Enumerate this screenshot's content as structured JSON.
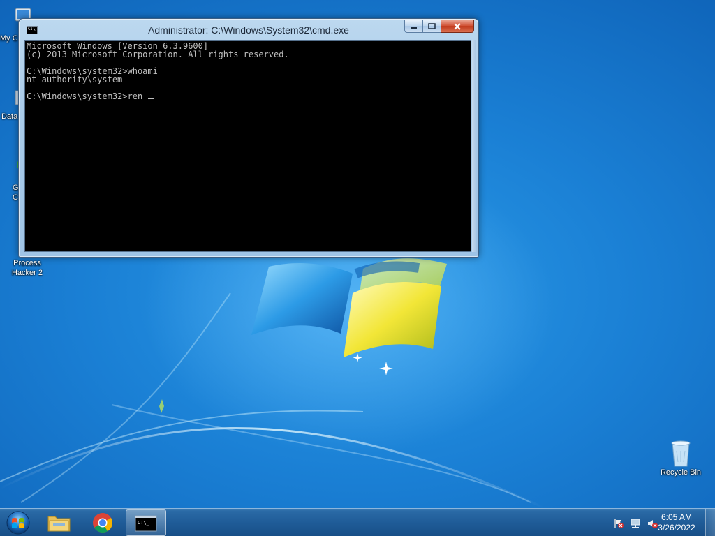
{
  "desktop": {
    "icons": [
      {
        "label": "My C",
        "icon": "computer-icon"
      },
      {
        "label": "Data",
        "icon": "shortcut-icon"
      },
      {
        "label": "G\nC",
        "icon": "shortcut-icon"
      },
      {
        "label": "Process\nHacker 2",
        "icon": "process-hacker-icon"
      },
      {
        "label": "Recycle Bin",
        "icon": "recycle-bin-icon"
      }
    ]
  },
  "cmd": {
    "title": "Administrator: C:\\Windows\\System32\\cmd.exe",
    "lines": [
      "Microsoft Windows [Version 6.3.9600]",
      "(c) 2013 Microsoft Corporation. All rights reserved.",
      "",
      "C:\\Windows\\system32>whoami",
      "nt authority\\system",
      "",
      "C:\\Windows\\system32>ren "
    ],
    "icon_text": "C:\\"
  },
  "taskbar": {
    "pinned": [
      "start-orb-icon",
      "file-explorer-icon",
      "chrome-icon",
      "cmd-icon"
    ],
    "active": "cmd-icon",
    "tray_icons": [
      "action-center-flag-icon",
      "network-icon",
      "volume-muted-icon"
    ],
    "clock": {
      "time": "6:05 AM",
      "date": "3/26/2022"
    }
  },
  "colors": {
    "console_bg": "#000000",
    "console_fg": "#c0c0c0",
    "taskbar": "#1f5c98",
    "desktop": "#1a7fd4"
  }
}
